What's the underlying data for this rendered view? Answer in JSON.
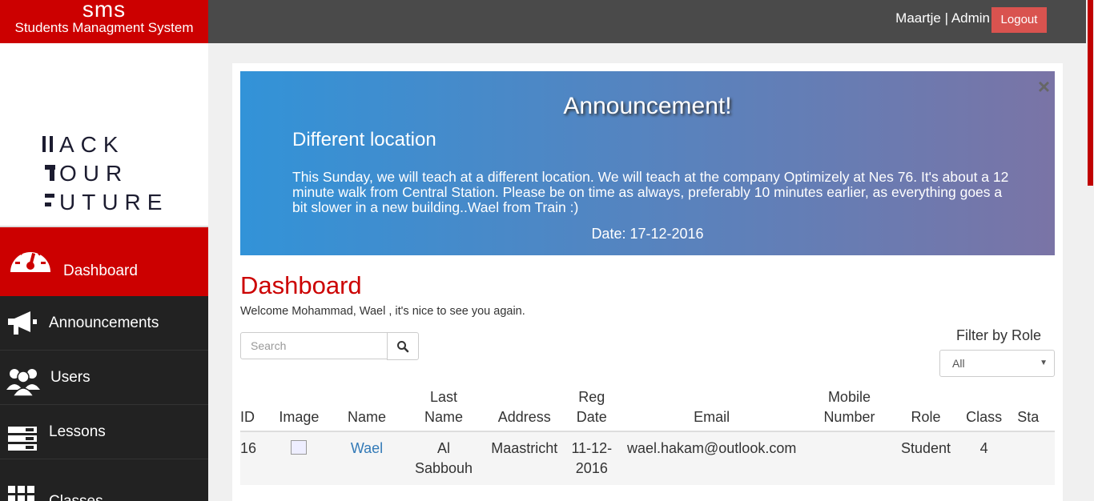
{
  "brand": {
    "abbr": "sms",
    "full": "Students Managment System"
  },
  "logo": {
    "line1": "ACK",
    "line2": "OUR",
    "line3": "UTURE"
  },
  "sidebar": {
    "items": [
      {
        "label": "Dashboard",
        "icon": "dashboard-icon",
        "active": true
      },
      {
        "label": "Announcements",
        "icon": "megaphone-icon"
      },
      {
        "label": "Users",
        "icon": "users-icon"
      },
      {
        "label": "Lessons",
        "icon": "lessons-icon"
      },
      {
        "label": "Classes",
        "icon": "grid-icon"
      }
    ]
  },
  "topbar": {
    "user": "Maartje",
    "separator": "|",
    "role": "Admin",
    "logout_label": "Logout"
  },
  "announcement": {
    "heading": "Announcement!",
    "title": "Different location",
    "body": "This Sunday, we will teach at a different location. We will teach at the company Optimizely at Nes 76. It's about a 12 minute walk from Central Station. Please be on time as always, preferably 10 minutes earlier, as everything goes a bit slower in a new building..Wael from Train :)",
    "date": "Date: 17-12-2016",
    "close": "×"
  },
  "dashboard": {
    "title": "Dashboard",
    "welcome": "Welcome Mohammad, Wael , it's nice to see you again.",
    "search_placeholder": "Search",
    "filter_label": "Filter by Role",
    "filter_value": "All"
  },
  "table": {
    "headers": [
      "ID",
      "Image",
      "Name",
      "Last Name",
      "Address",
      "Reg Date",
      "Email",
      "Mobile Number",
      "Role",
      "Class",
      "Sta"
    ],
    "rows": [
      {
        "id": "16",
        "name": "Wael",
        "last_name": "Al Sabbouh",
        "address": "Maastricht",
        "reg_date": "11-12-2016",
        "email": "wael.hakam@outlook.com",
        "mobile": "",
        "role": "Student",
        "class": "4"
      }
    ]
  },
  "colors": {
    "brand_red": "#cc0000",
    "topbar": "#4a4a4a",
    "sidebar": "#222222",
    "logout": "#d9534f",
    "link": "#337ab7"
  }
}
